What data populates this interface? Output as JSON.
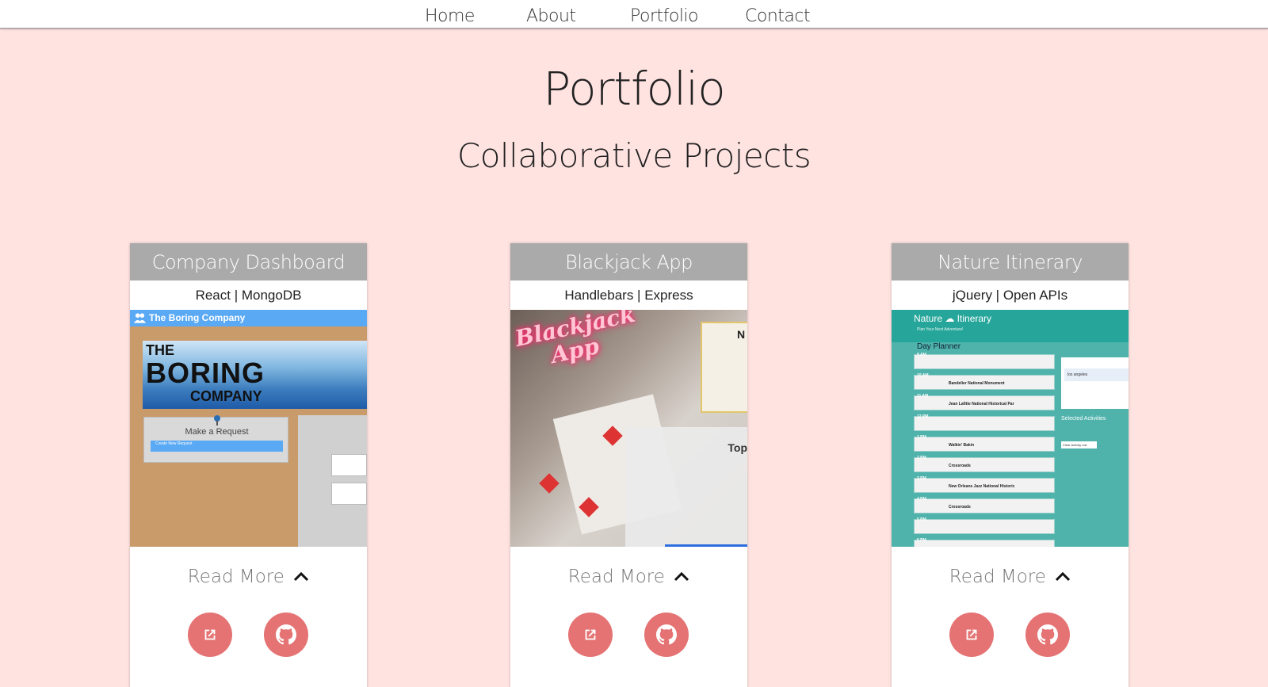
{
  "nav": {
    "items": [
      {
        "label": "Home"
      },
      {
        "label": "About"
      },
      {
        "label": "Portfolio"
      },
      {
        "label": "Contact"
      }
    ]
  },
  "page": {
    "title": "Portfolio",
    "section_title": "Collaborative Projects"
  },
  "projects": [
    {
      "title": "Company Dashboard",
      "tech": "React | MongoDB",
      "read_more": "Read More",
      "screenshot": {
        "app_name": "The Boring Company",
        "logo_line1": "THE",
        "logo_line2": "BORING",
        "logo_line3": "COMPANY",
        "form_label": "Make a Request",
        "select_value": "Create New Request"
      }
    },
    {
      "title": "Blackjack App",
      "tech": "Handlebars | Express",
      "read_more": "Read More",
      "screenshot": {
        "neon_line1": "Blackjack",
        "neon_line2": "App",
        "panel_label": "Top"
      }
    },
    {
      "title": "Nature Itinerary",
      "tech": "jQuery | Open APIs",
      "read_more": "Read More",
      "screenshot": {
        "app_name": "Nature ☁ Itinerary",
        "tagline": "Plan Your Next Adventure!",
        "planner_label": "Day Planner",
        "search_value": "los angeles",
        "selected_label": "Selected Activities",
        "clear_label": "Clear Activity List",
        "rows": [
          {
            "hour": "9 AM",
            "activity": ""
          },
          {
            "hour": "10 AM",
            "activity": "Bandelier National Monument"
          },
          {
            "hour": "11 AM",
            "activity": "Jean Lafitte National Historical Par"
          },
          {
            "hour": "12 PM",
            "activity": ""
          },
          {
            "hour": "1 PM",
            "activity": "Walkin' Bakin"
          },
          {
            "hour": "2 PM",
            "activity": "Crossroads"
          },
          {
            "hour": "3 PM",
            "activity": "New Orleans Jazz National Historic"
          },
          {
            "hour": "4 PM",
            "activity": "Crossroads"
          },
          {
            "hour": "5 PM",
            "activity": ""
          },
          {
            "hour": "6 PM",
            "activity": ""
          }
        ]
      }
    }
  ],
  "colors": {
    "background": "#ffe3e1",
    "card_header": "#aaaaaa",
    "icon_button": "#e57373",
    "nature_teal": "#26a69a",
    "blackjack_neon": "#ff2a6d"
  },
  "icons": {
    "external_link": "external-link-icon",
    "github": "github-icon",
    "chevron": "chevron-up-icon"
  }
}
